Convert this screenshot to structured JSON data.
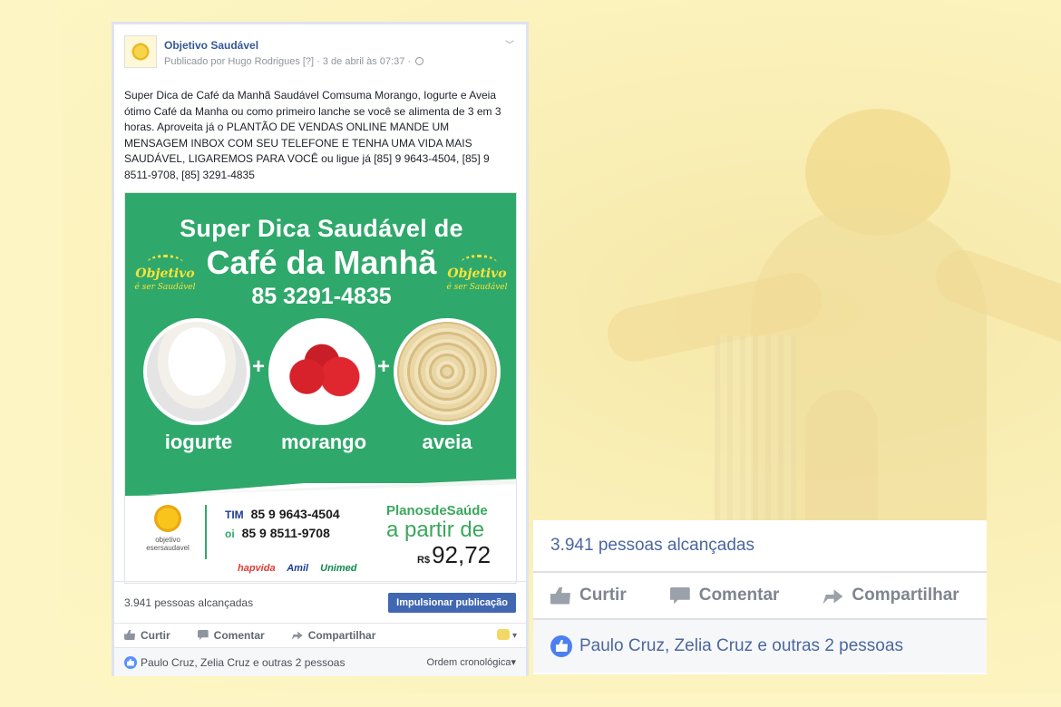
{
  "post": {
    "page_name": "Objetivo Saudável",
    "published_by": "Publicado por Hugo Rodrigues [?] · 3 de abril às 07:37 ·",
    "text": "Super Dica de Café da Manhã Saudável Comsuma Morango, Iogurte e Aveia ótimo Café da Manha ou como primeiro lanche se você se alimenta de 3 em 3 horas. Aproveita já o PLANTÃO DE VENDAS ONLINE MANDE UM MENSAGEM INBOX COM SEU TELEFONE E TENHA UMA VIDA MAIS SAUDÁVEL, LIGAREMOS PARA VOCÊ ou ligue já [85] 9 9643-4504, [85] 9 8511-9708, [85] 3291-4835",
    "icons": [
      "globe-icon",
      "chevron-down-icon"
    ]
  },
  "image": {
    "title1": "Super Dica Saudável de",
    "title2": "Café da Manhã",
    "phone": "85 3291-4835",
    "logo_main": "Objetivo",
    "logo_sub": "é ser Saudável",
    "plus": "+",
    "foods": [
      "iogurte",
      "morango",
      "aveia"
    ],
    "bottom": {
      "logo_line1": "objetivo",
      "logo_line2": "esersaudavel",
      "tim_tag": "TIM",
      "tim_number": "85 9 9643-4504",
      "oi_tag": "oi",
      "oi_number": "85 9 8511-9708",
      "planos": "PlanosdeSaúde",
      "partir": "a partir de",
      "currency": "R$",
      "price": "92,72",
      "brands": [
        "hapvida",
        "Amil",
        "Unimed"
      ]
    }
  },
  "stats": {
    "reached": "3.941 pessoas alcançadas",
    "boost_button": "Impulsionar publicação",
    "like_label": "Curtir",
    "comment_label": "Comentar",
    "share_label": "Compartilhar",
    "likes_text": "Paulo Cruz, Zelia Cruz e outras 2 pessoas",
    "order_label": "Ordem cronológica",
    "order_caret": "▾",
    "emoji_caret": "▾"
  },
  "colors": {
    "facebook_blue": "#4267b2",
    "green": "#2fa86b",
    "background": "#fdf6c4"
  }
}
